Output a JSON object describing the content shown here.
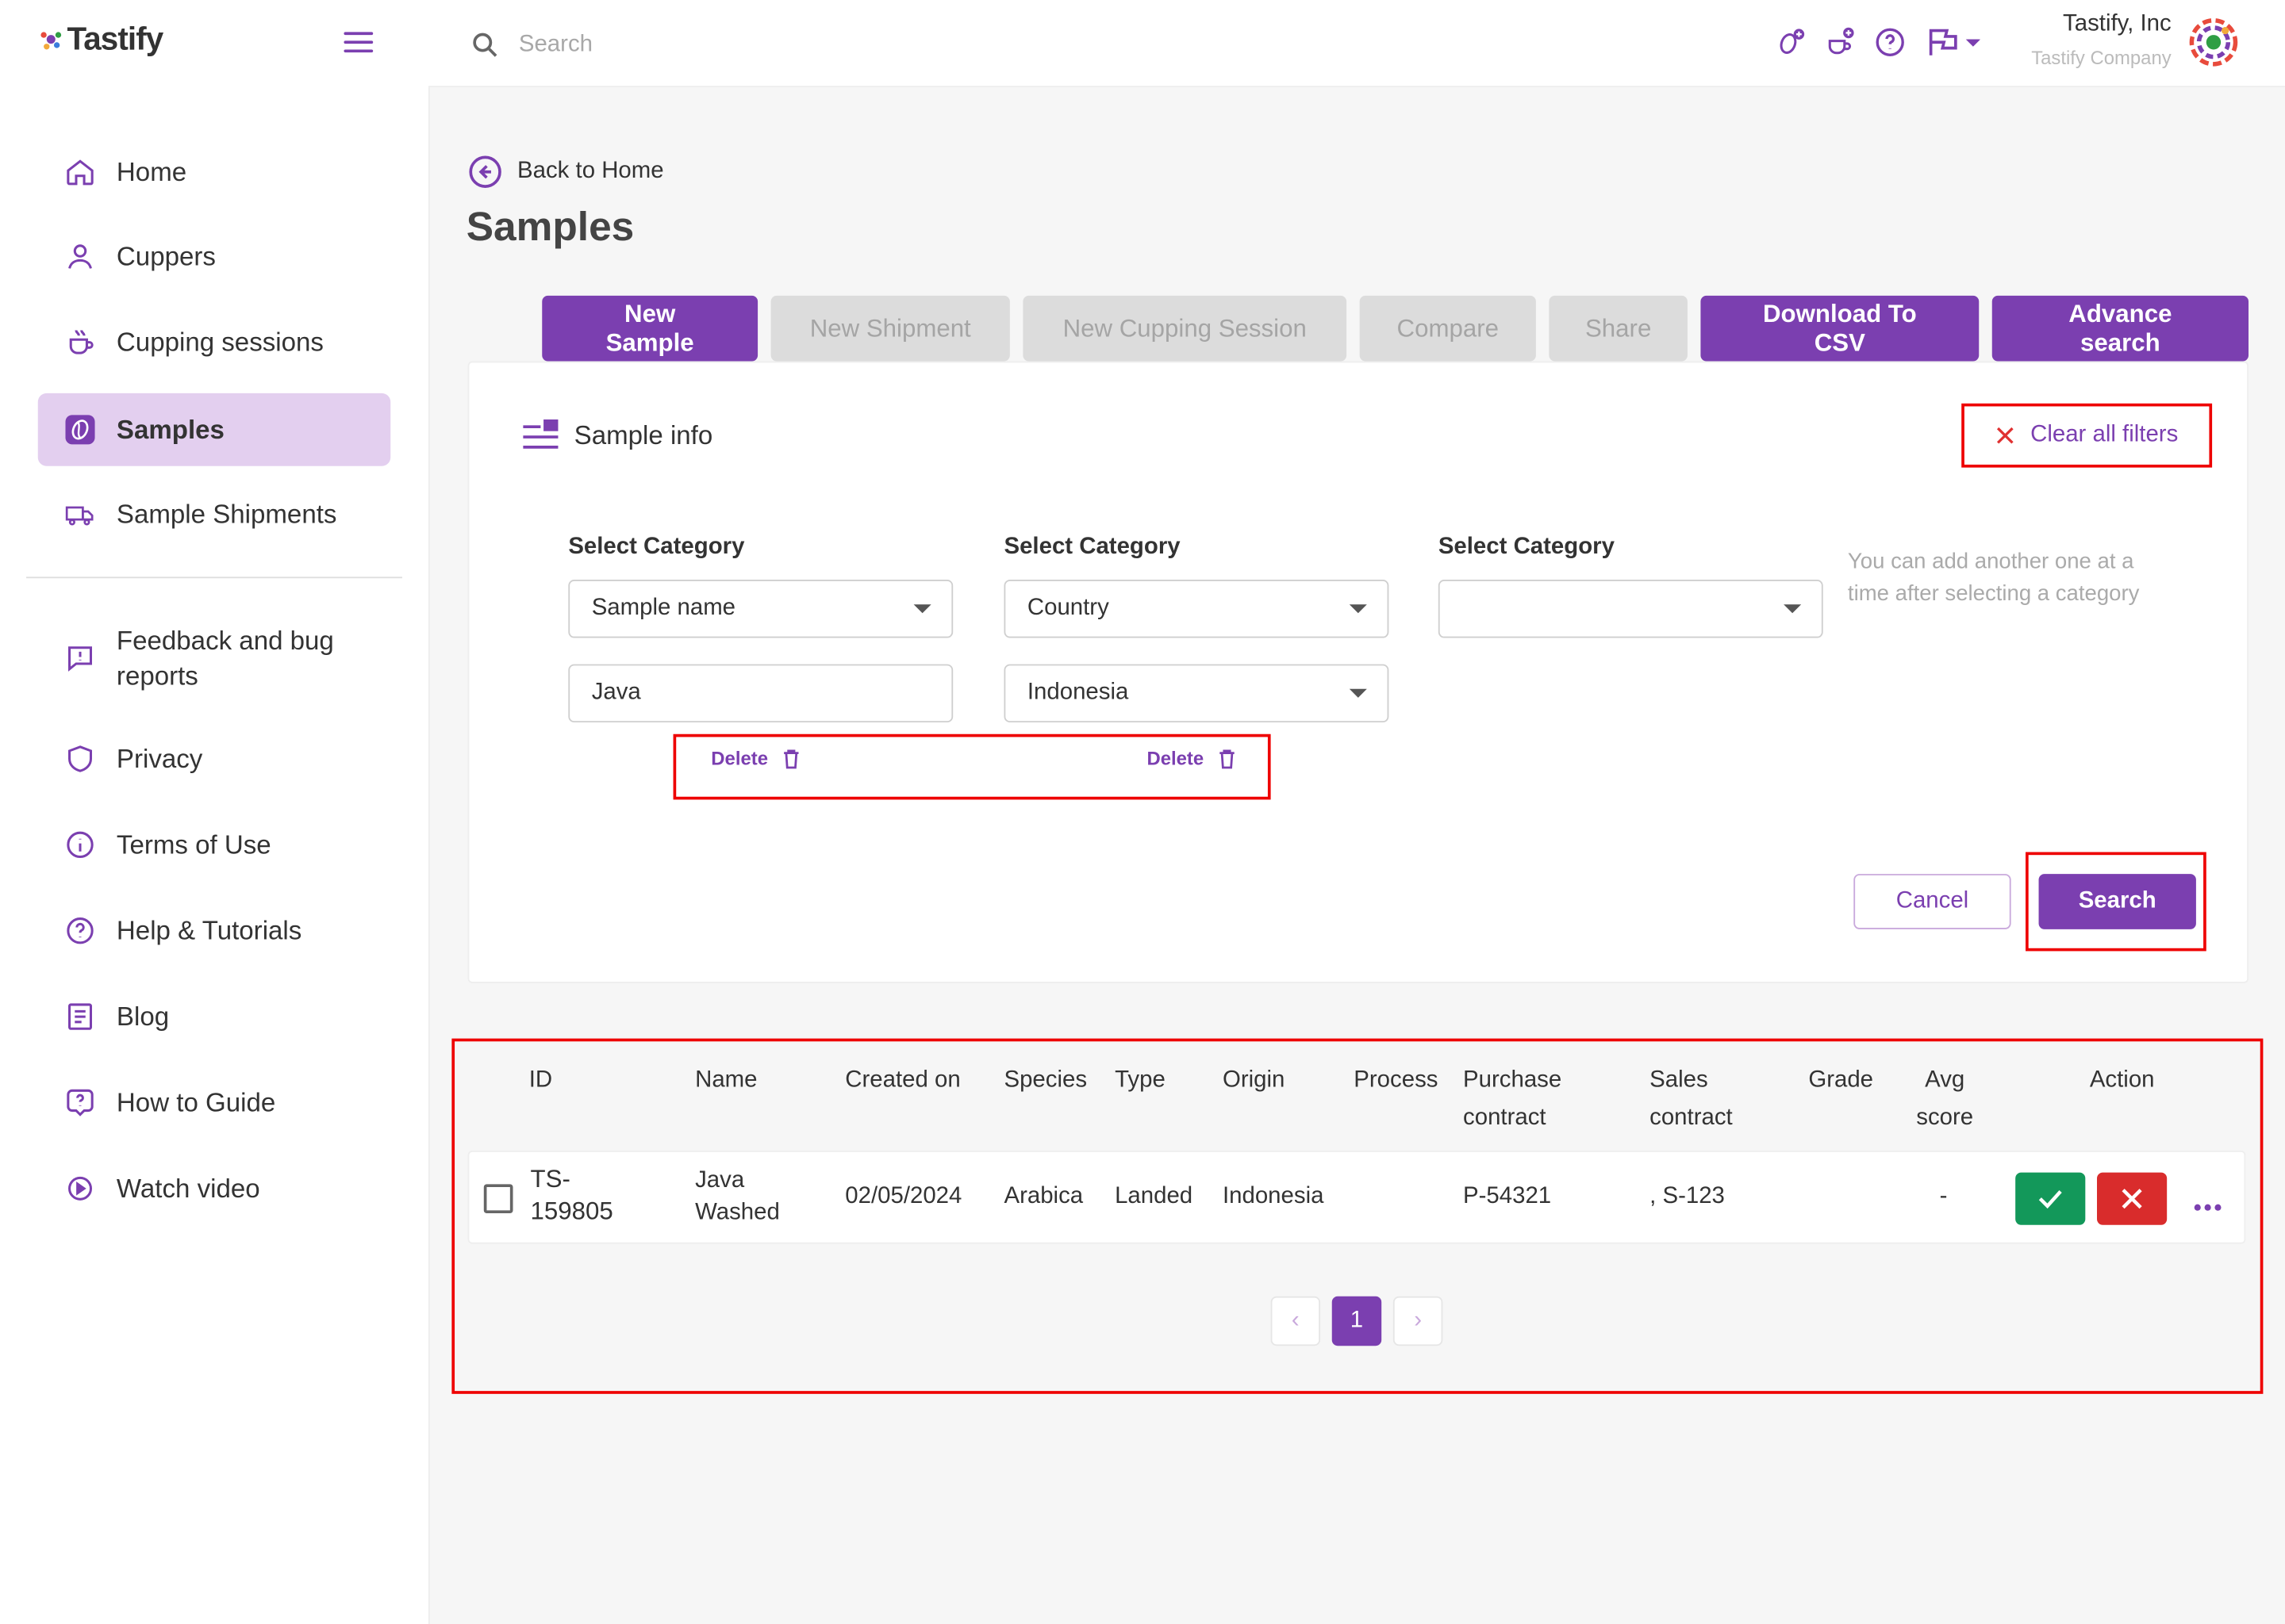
{
  "app": {
    "name": "Tastify"
  },
  "colors": {
    "accent": "#7b3fb0",
    "active_bg": "#e3cfef",
    "annotation": "#e00000",
    "approve": "#13985a",
    "reject": "#d92c2c"
  },
  "sidebar": {
    "items": [
      {
        "label": "Home",
        "icon": "home-icon"
      },
      {
        "label": "Cuppers",
        "icon": "user-icon"
      },
      {
        "label": "Cupping sessions",
        "icon": "cup-icon"
      },
      {
        "label": "Samples",
        "icon": "coffee-bean-icon",
        "active": true
      },
      {
        "label": "Sample Shipments",
        "icon": "truck-icon"
      }
    ],
    "secondary_items": [
      {
        "label": "Feedback and bug reports",
        "icon": "feedback-icon"
      },
      {
        "label": "Privacy",
        "icon": "shield-icon"
      },
      {
        "label": "Terms of Use",
        "icon": "info-icon"
      },
      {
        "label": "Help & Tutorials",
        "icon": "help-icon"
      },
      {
        "label": "Blog",
        "icon": "blog-icon"
      },
      {
        "label": "How to Guide",
        "icon": "guide-icon"
      },
      {
        "label": "Watch video",
        "icon": "play-icon"
      }
    ]
  },
  "topbar": {
    "search_placeholder": "Search",
    "company_name": "Tastify, Inc",
    "company_sub": "Tastify Company"
  },
  "main": {
    "back_label": "Back to Home",
    "title": "Samples",
    "buttons": {
      "new_sample": "New Sample",
      "new_shipment": "New Shipment",
      "new_cupping": "New Cupping Session",
      "compare": "Compare",
      "share": "Share",
      "download_csv": "Download To CSV",
      "advance_search": "Advance search"
    }
  },
  "filter_panel": {
    "title": "Sample info",
    "clear_label": "Clear all filters",
    "category_label": "Select Category",
    "cat1_value": "Sample name",
    "cat2_value": "Country",
    "cat3_value": "",
    "val1_value": "Java",
    "val2_value": "Indonesia",
    "hint": "You can add another one at a time after selecting a category",
    "hint_line1": "You can add another one at a",
    "hint_line2": "time after selecting a category",
    "delete_label": "Delete",
    "cancel_label": "Cancel",
    "search_label": "Search"
  },
  "table": {
    "headers": {
      "id": "ID",
      "name": "Name",
      "created": "Created on",
      "species": "Species",
      "type": "Type",
      "origin": "Origin",
      "process": "Process",
      "purchase_1": "Purchase",
      "purchase_2": "contract",
      "sales_1": "Sales",
      "sales_2": "contract",
      "grade": "Grade",
      "avg_1": "Avg",
      "avg_2": "score",
      "action": "Action"
    },
    "rows": [
      {
        "id_1": "TS-",
        "id_2": "159805",
        "name_1": "Java",
        "name_2": "Washed",
        "created": "02/05/2024",
        "species": "Arabica",
        "type": "Landed",
        "origin": "Indonesia",
        "process": "",
        "purchase": "P-54321",
        "sales": ", S-123",
        "grade": "",
        "avg": "-"
      }
    ]
  },
  "pagination": {
    "prev": "‹",
    "current": "1",
    "next": "›"
  }
}
